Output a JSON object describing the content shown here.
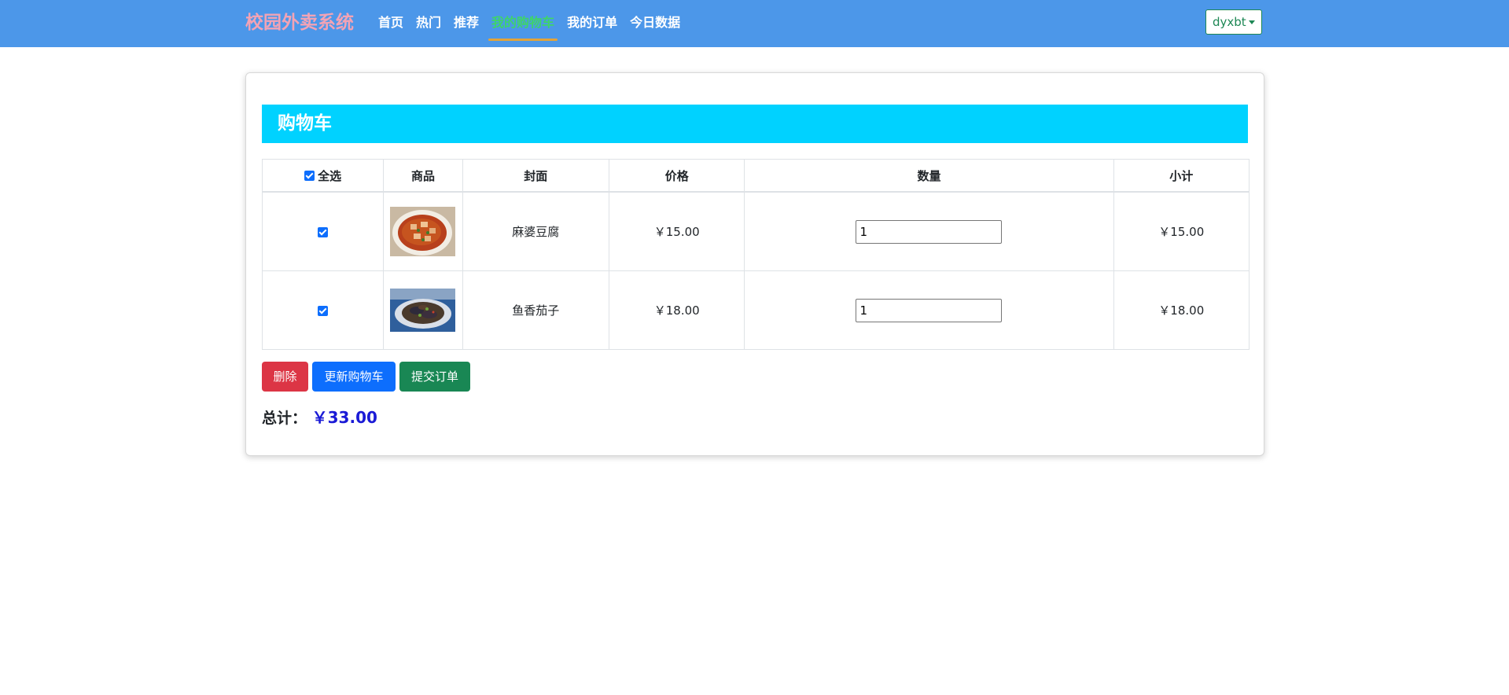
{
  "nav": {
    "brand": "校园外卖系统",
    "links": [
      "首页",
      "热门",
      "推荐",
      "我的购物车",
      "我的订单",
      "今日数据"
    ],
    "active_index": 3,
    "user": "dyxbt"
  },
  "cart": {
    "title": "购物车",
    "headers": {
      "select_all": "全选",
      "product": "商品",
      "cover": "封面",
      "price": "价格",
      "quantity": "数量",
      "subtotal": "小计"
    },
    "rows": [
      {
        "name": "麻婆豆腐",
        "price": "￥15.00",
        "quantity": "1",
        "subtotal": "￥15.00",
        "image": "mapo-tofu-photo"
      },
      {
        "name": "鱼香茄子",
        "price": "￥18.00",
        "quantity": "1",
        "subtotal": "￥18.00",
        "image": "eggplant-dish-photo"
      }
    ],
    "buttons": {
      "delete": "删除",
      "update": "更新购物车",
      "submit": "提交订单"
    },
    "total_label": "总计：",
    "total_value": "￥33.00"
  },
  "colors": {
    "navbar_bg": "#4c97e9",
    "brand": "#f2a3b5",
    "active_link": "#3ed46a",
    "active_underline": "#e2a33a",
    "cart_header_bg": "#00d2ff",
    "btn_delete": "#dc3545",
    "btn_update": "#0d6efd",
    "btn_submit": "#198754",
    "total_value": "#1a1ad6"
  }
}
